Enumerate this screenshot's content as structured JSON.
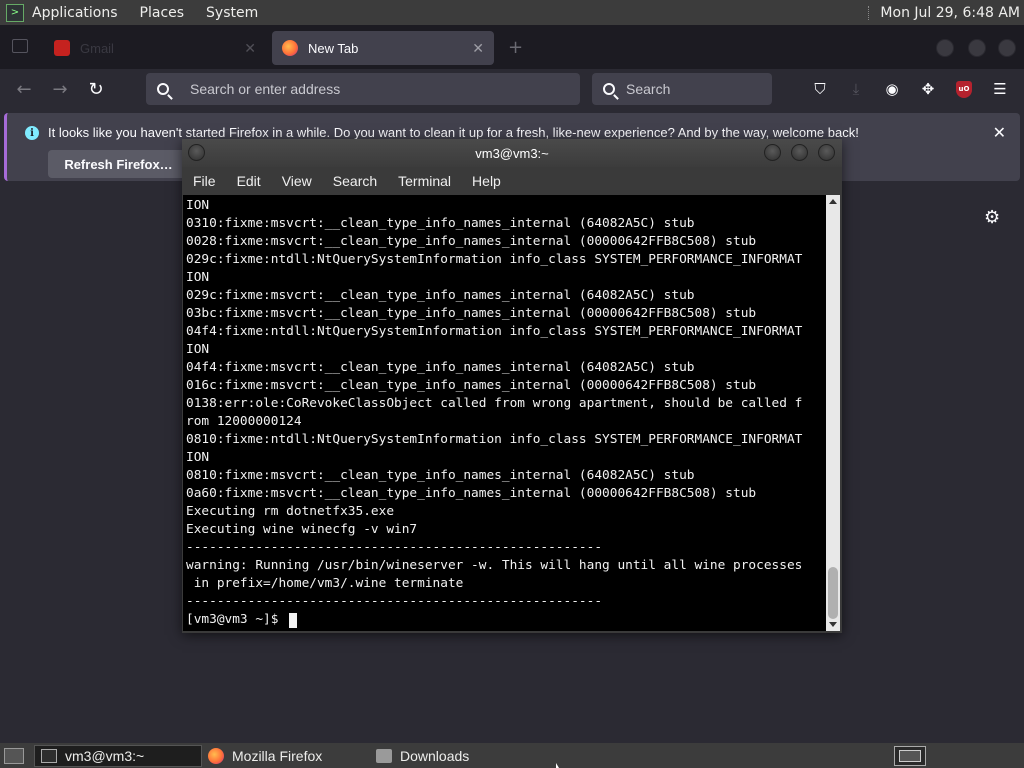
{
  "top_panel": {
    "menus": [
      "Applications",
      "Places",
      "System"
    ],
    "clock": "Mon Jul 29,  6:48 AM"
  },
  "firefox": {
    "tabs": [
      {
        "label": "Gmail",
        "active": false
      },
      {
        "label": "New Tab",
        "active": true
      }
    ],
    "urlbar_placeholder": "Search or enter address",
    "searchbar_placeholder": "Search",
    "notification": {
      "message": "It looks like you haven't started Firefox in a while. Do you want to clean it up for a fresh, like-new experience? And by the way, welcome back!",
      "button": "Refresh Firefox…"
    },
    "colors": {
      "accent": "#a66bd8",
      "ublock": "#b5222e"
    }
  },
  "terminal": {
    "title": "vm3@vm3:~",
    "menus": [
      "File",
      "Edit",
      "View",
      "Search",
      "Terminal",
      "Help"
    ],
    "lines": [
      "ION",
      "0310:fixme:msvcrt:__clean_type_info_names_internal (64082A5C) stub",
      "0028:fixme:msvcrt:__clean_type_info_names_internal (00000642FFB8C508) stub",
      "029c:fixme:ntdll:NtQuerySystemInformation info_class SYSTEM_PERFORMANCE_INFORMAT",
      "ION",
      "029c:fixme:msvcrt:__clean_type_info_names_internal (64082A5C) stub",
      "03bc:fixme:msvcrt:__clean_type_info_names_internal (00000642FFB8C508) stub",
      "04f4:fixme:ntdll:NtQuerySystemInformation info_class SYSTEM_PERFORMANCE_INFORMAT",
      "ION",
      "04f4:fixme:msvcrt:__clean_type_info_names_internal (64082A5C) stub",
      "016c:fixme:msvcrt:__clean_type_info_names_internal (00000642FFB8C508) stub",
      "0138:err:ole:CoRevokeClassObject called from wrong apartment, should be called f",
      "rom 12000000124",
      "0810:fixme:ntdll:NtQuerySystemInformation info_class SYSTEM_PERFORMANCE_INFORMAT",
      "ION",
      "0810:fixme:msvcrt:__clean_type_info_names_internal (64082A5C) stub",
      "0a60:fixme:msvcrt:__clean_type_info_names_internal (00000642FFB8C508) stub",
      "Executing rm dotnetfx35.exe",
      "Executing wine winecfg -v win7",
      "------------------------------------------------------",
      "warning: Running /usr/bin/wineserver -w. This will hang until all wine processes",
      " in prefix=/home/vm3/.wine terminate",
      "------------------------------------------------------"
    ],
    "prompt": "[vm3@vm3 ~]$ "
  },
  "taskbar": {
    "tasks": [
      {
        "label": "vm3@vm3:~",
        "active": true
      },
      {
        "label": "Mozilla Firefox",
        "active": false
      },
      {
        "label": "Downloads",
        "active": false
      }
    ]
  }
}
